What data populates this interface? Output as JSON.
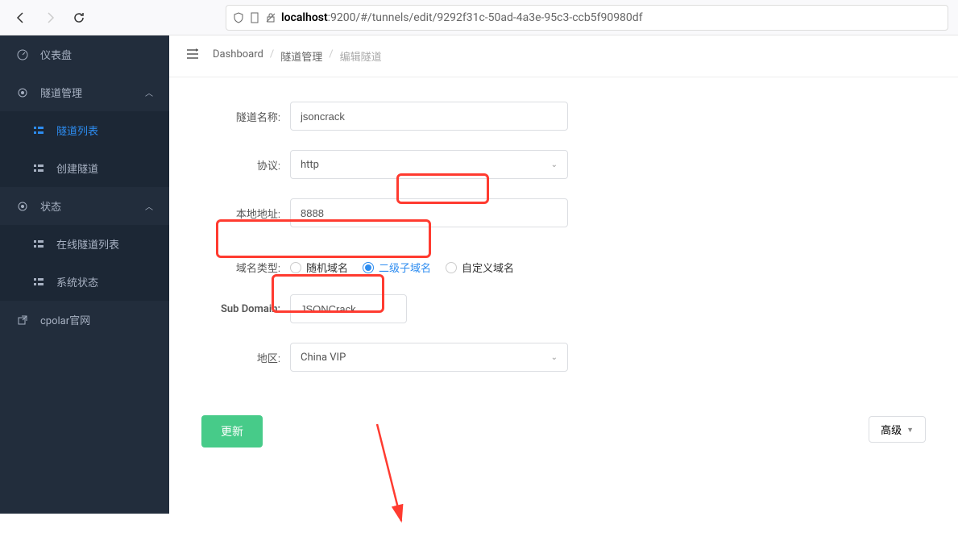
{
  "url": {
    "prefix": "localhost",
    "suffix": ":9200/#/tunnels/edit/9292f31c-50ad-4a3e-95c3-ccb5f90980df"
  },
  "sidebar": {
    "items": [
      {
        "label": "仪表盘",
        "icon": "dashboard"
      },
      {
        "label": "隧道管理",
        "icon": "tunnel",
        "expandable": true
      },
      {
        "label": "隧道列表",
        "sub": true,
        "active": true
      },
      {
        "label": "创建隧道",
        "sub": true
      },
      {
        "label": "状态",
        "icon": "status",
        "expandable": true
      },
      {
        "label": "在线隧道列表",
        "sub": true
      },
      {
        "label": "系统状态",
        "sub": true
      },
      {
        "label": "cpolar官网",
        "icon": "external"
      }
    ]
  },
  "breadcrumb": {
    "items": [
      "Dashboard",
      "隧道管理",
      "编辑隧道"
    ]
  },
  "form": {
    "tunnel_name_label": "隧道名称:",
    "tunnel_name_value": "jsoncrack",
    "protocol_label": "协议:",
    "protocol_value": "http",
    "local_addr_label": "本地地址:",
    "local_addr_value": "8888",
    "domain_type_label": "域名类型:",
    "domain_options": {
      "random": "随机域名",
      "subdomain": "二级子域名",
      "custom": "自定义域名"
    },
    "subdomain_label": "Sub Domain:",
    "subdomain_value": "JSONCrack",
    "region_label": "地区:",
    "region_value": "China VIP",
    "advanced_label": "高级",
    "update_label": "更新"
  }
}
